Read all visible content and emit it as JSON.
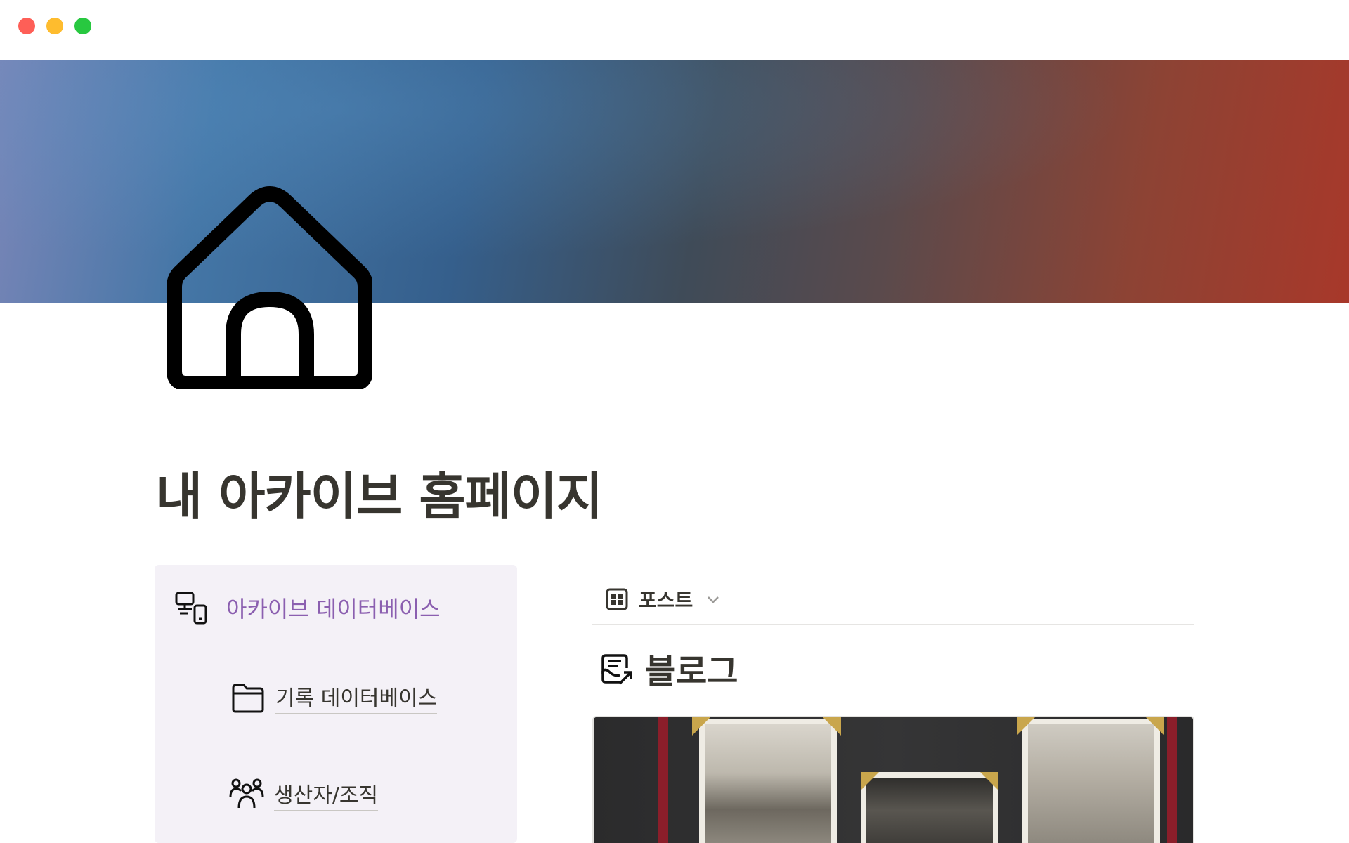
{
  "window": {
    "controls": [
      "close",
      "minimize",
      "maximize"
    ]
  },
  "cover": {
    "gradient_colors": [
      "#7b86b8",
      "#4476a6",
      "#355f8c",
      "#3f4b58",
      "#8d4334",
      "#a8382a"
    ]
  },
  "page": {
    "icon": "home-icon",
    "title": "내 아카이브 홈페이지"
  },
  "callout": {
    "background": "#f4f1f7",
    "icon": "devices-icon",
    "title": "아카이브 데이터베이스",
    "title_color": "#8b5fb0",
    "links": [
      {
        "icon": "folder-icon",
        "label": "기록 데이터베이스"
      },
      {
        "icon": "people-icon",
        "label": "생산자/조직"
      }
    ]
  },
  "database": {
    "view": {
      "icon": "gallery-view-icon",
      "label": "포스트"
    },
    "heading": {
      "icon": "blog-icon",
      "label": "블로그"
    },
    "cards": [
      {
        "cover": "photo-album-image"
      }
    ]
  }
}
